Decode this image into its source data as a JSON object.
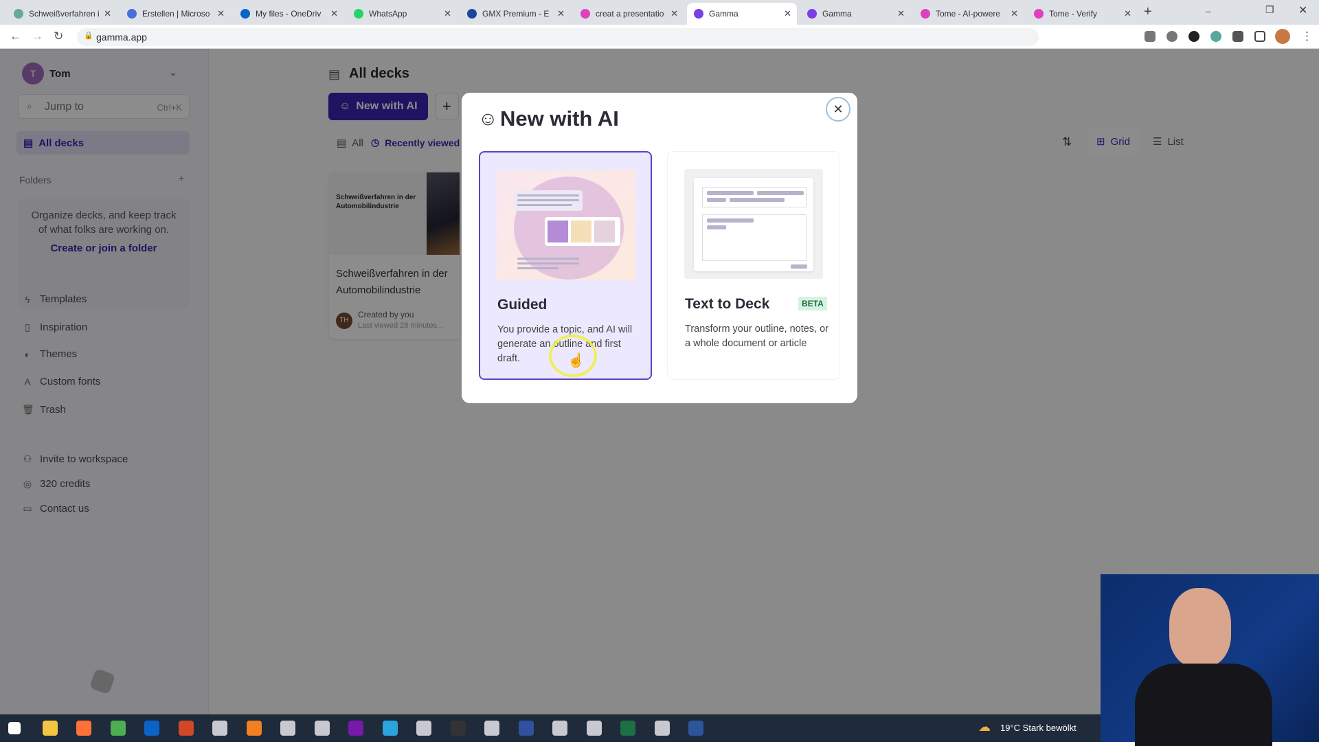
{
  "browser": {
    "tabs": [
      {
        "label": "Schweißverfahren i",
        "color": "#6a9"
      },
      {
        "label": "Erstellen | Microso",
        "color": "#4a6fd8"
      },
      {
        "label": "My files - OneDriv",
        "color": "#0a64c8"
      },
      {
        "label": "WhatsApp",
        "color": "#25d366"
      },
      {
        "label": "GMX Premium - E",
        "color": "#1c449b"
      },
      {
        "label": "creat a presentatio",
        "color": "#e040c0"
      },
      {
        "label": "Gamma",
        "color": "#7b3fe4",
        "active": true
      },
      {
        "label": "Gamma",
        "color": "#7b3fe4"
      },
      {
        "label": "Tome - AI-powere",
        "color": "#e040c0"
      },
      {
        "label": "Tome - Verify",
        "color": "#e040c0"
      }
    ],
    "url": "gamma.app"
  },
  "sidebar": {
    "user": {
      "initial": "T",
      "name": "Tom"
    },
    "search": {
      "placeholder": "Jump to",
      "shortcut": "Ctrl+K"
    },
    "all_decks": "All decks",
    "folders_label": "Folders",
    "folders_empty": "Organize decks, and keep track of what folks are working on.",
    "folders_link": "Create or join a folder",
    "nav": [
      {
        "label": "Templates",
        "icon": "lightning-icon"
      },
      {
        "label": "Inspiration",
        "icon": "book-icon"
      },
      {
        "label": "Themes",
        "icon": "palette-icon"
      },
      {
        "label": "Custom fonts",
        "icon": "font-icon"
      },
      {
        "label": "Trash",
        "icon": "trash-icon"
      }
    ],
    "footer": [
      {
        "label": "Invite to workspace",
        "icon": "add-user-icon"
      },
      {
        "label": "320 credits",
        "icon": "credits-icon"
      },
      {
        "label": "Contact us",
        "icon": "chat-icon"
      }
    ]
  },
  "main": {
    "title": "All decks",
    "new_ai": "New with AI",
    "new_plus": "+",
    "filters": [
      "All",
      "Recently viewed"
    ],
    "sort_icon": "sort-icon",
    "views": [
      "Grid",
      "List"
    ],
    "deck": {
      "thumb_title": "Schweißverfahren in der Automobilindustrie",
      "title": "Schweißverfahren in der Automobilindustrie",
      "avatar": "TH",
      "created": "Created by you",
      "viewed": "Last viewed 28 minutes..."
    }
  },
  "modal": {
    "title": "New with AI",
    "options": [
      {
        "title": "Guided",
        "desc": "You provide a topic, and AI will generate an outline and first draft.",
        "selected": true
      },
      {
        "title": "Text to Deck",
        "badge": "BETA",
        "desc": "Transform your outline, notes, or a whole document or article"
      }
    ]
  },
  "taskbar": {
    "apps": [
      "windows",
      "explorer",
      "firefox",
      "chrome",
      "outlook",
      "powerpoint",
      "app",
      "vlc",
      "app",
      "app",
      "onenote",
      "telegram",
      "app",
      "obs",
      "app",
      "blue",
      "app",
      "app",
      "excel",
      "app",
      "word"
    ],
    "weather": "19°C  Stark bewölkt"
  },
  "colors": {
    "accent": "#3b1fc9",
    "selected_card": "#ece8fd",
    "beta": "#d5f3e2"
  }
}
